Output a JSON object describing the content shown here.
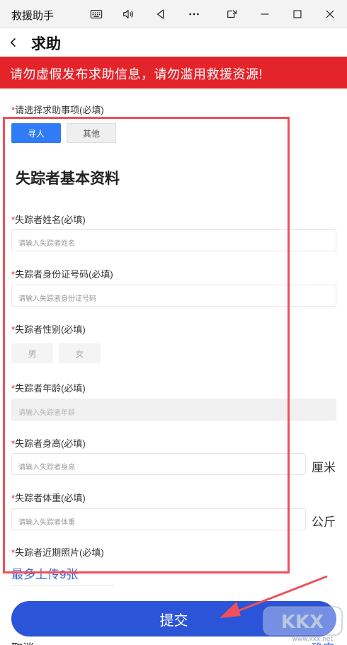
{
  "window": {
    "title": "救援助手",
    "controls": [
      "keyboard-icon",
      "volume-icon",
      "back-triangle-icon",
      "more-icon",
      "pip-icon",
      "minimize-icon",
      "maximize-icon",
      "close-icon"
    ]
  },
  "nav": {
    "title": "求助"
  },
  "warning_banner": "请勿虚假发布求助信息，请勿滥用救援资源!",
  "form": {
    "help_type": {
      "label": "请选择求助事项(必填)",
      "options": [
        "寻人",
        "其他"
      ],
      "selected": "寻人"
    },
    "section_title": "失踪者基本资料",
    "name": {
      "label": "失踪者姓名(必填)",
      "placeholder": "请输入失踪者姓名"
    },
    "id_number": {
      "label": "失踪者身份证号码(必填)",
      "placeholder": "请输入失踪者身份证号码"
    },
    "gender": {
      "label": "失踪者性别(必填)",
      "options": [
        "男",
        "女"
      ]
    },
    "age": {
      "label": "失踪者年龄(必填)",
      "placeholder": "请输入失踪者年龄"
    },
    "height": {
      "label": "失踪者身高(必填)",
      "placeholder": "请输入失踪者身高",
      "unit": "厘米"
    },
    "weight": {
      "label": "失踪者体重(必填)",
      "placeholder": "请输入失踪者体重",
      "unit": "公斤"
    },
    "photos": {
      "label": "失踪者近期照片(必填)",
      "hint": "最多上传9张"
    },
    "required_mark": "*"
  },
  "actions": {
    "submit": "提交",
    "cancel": "取消",
    "confirm": "确定"
  },
  "watermark": "www.kkx.net",
  "colors": {
    "banner_red": "#e3242b",
    "primary_blue": "#2b54d8",
    "selected_blue": "#2f7cf6",
    "highlight": "#f0505a"
  }
}
